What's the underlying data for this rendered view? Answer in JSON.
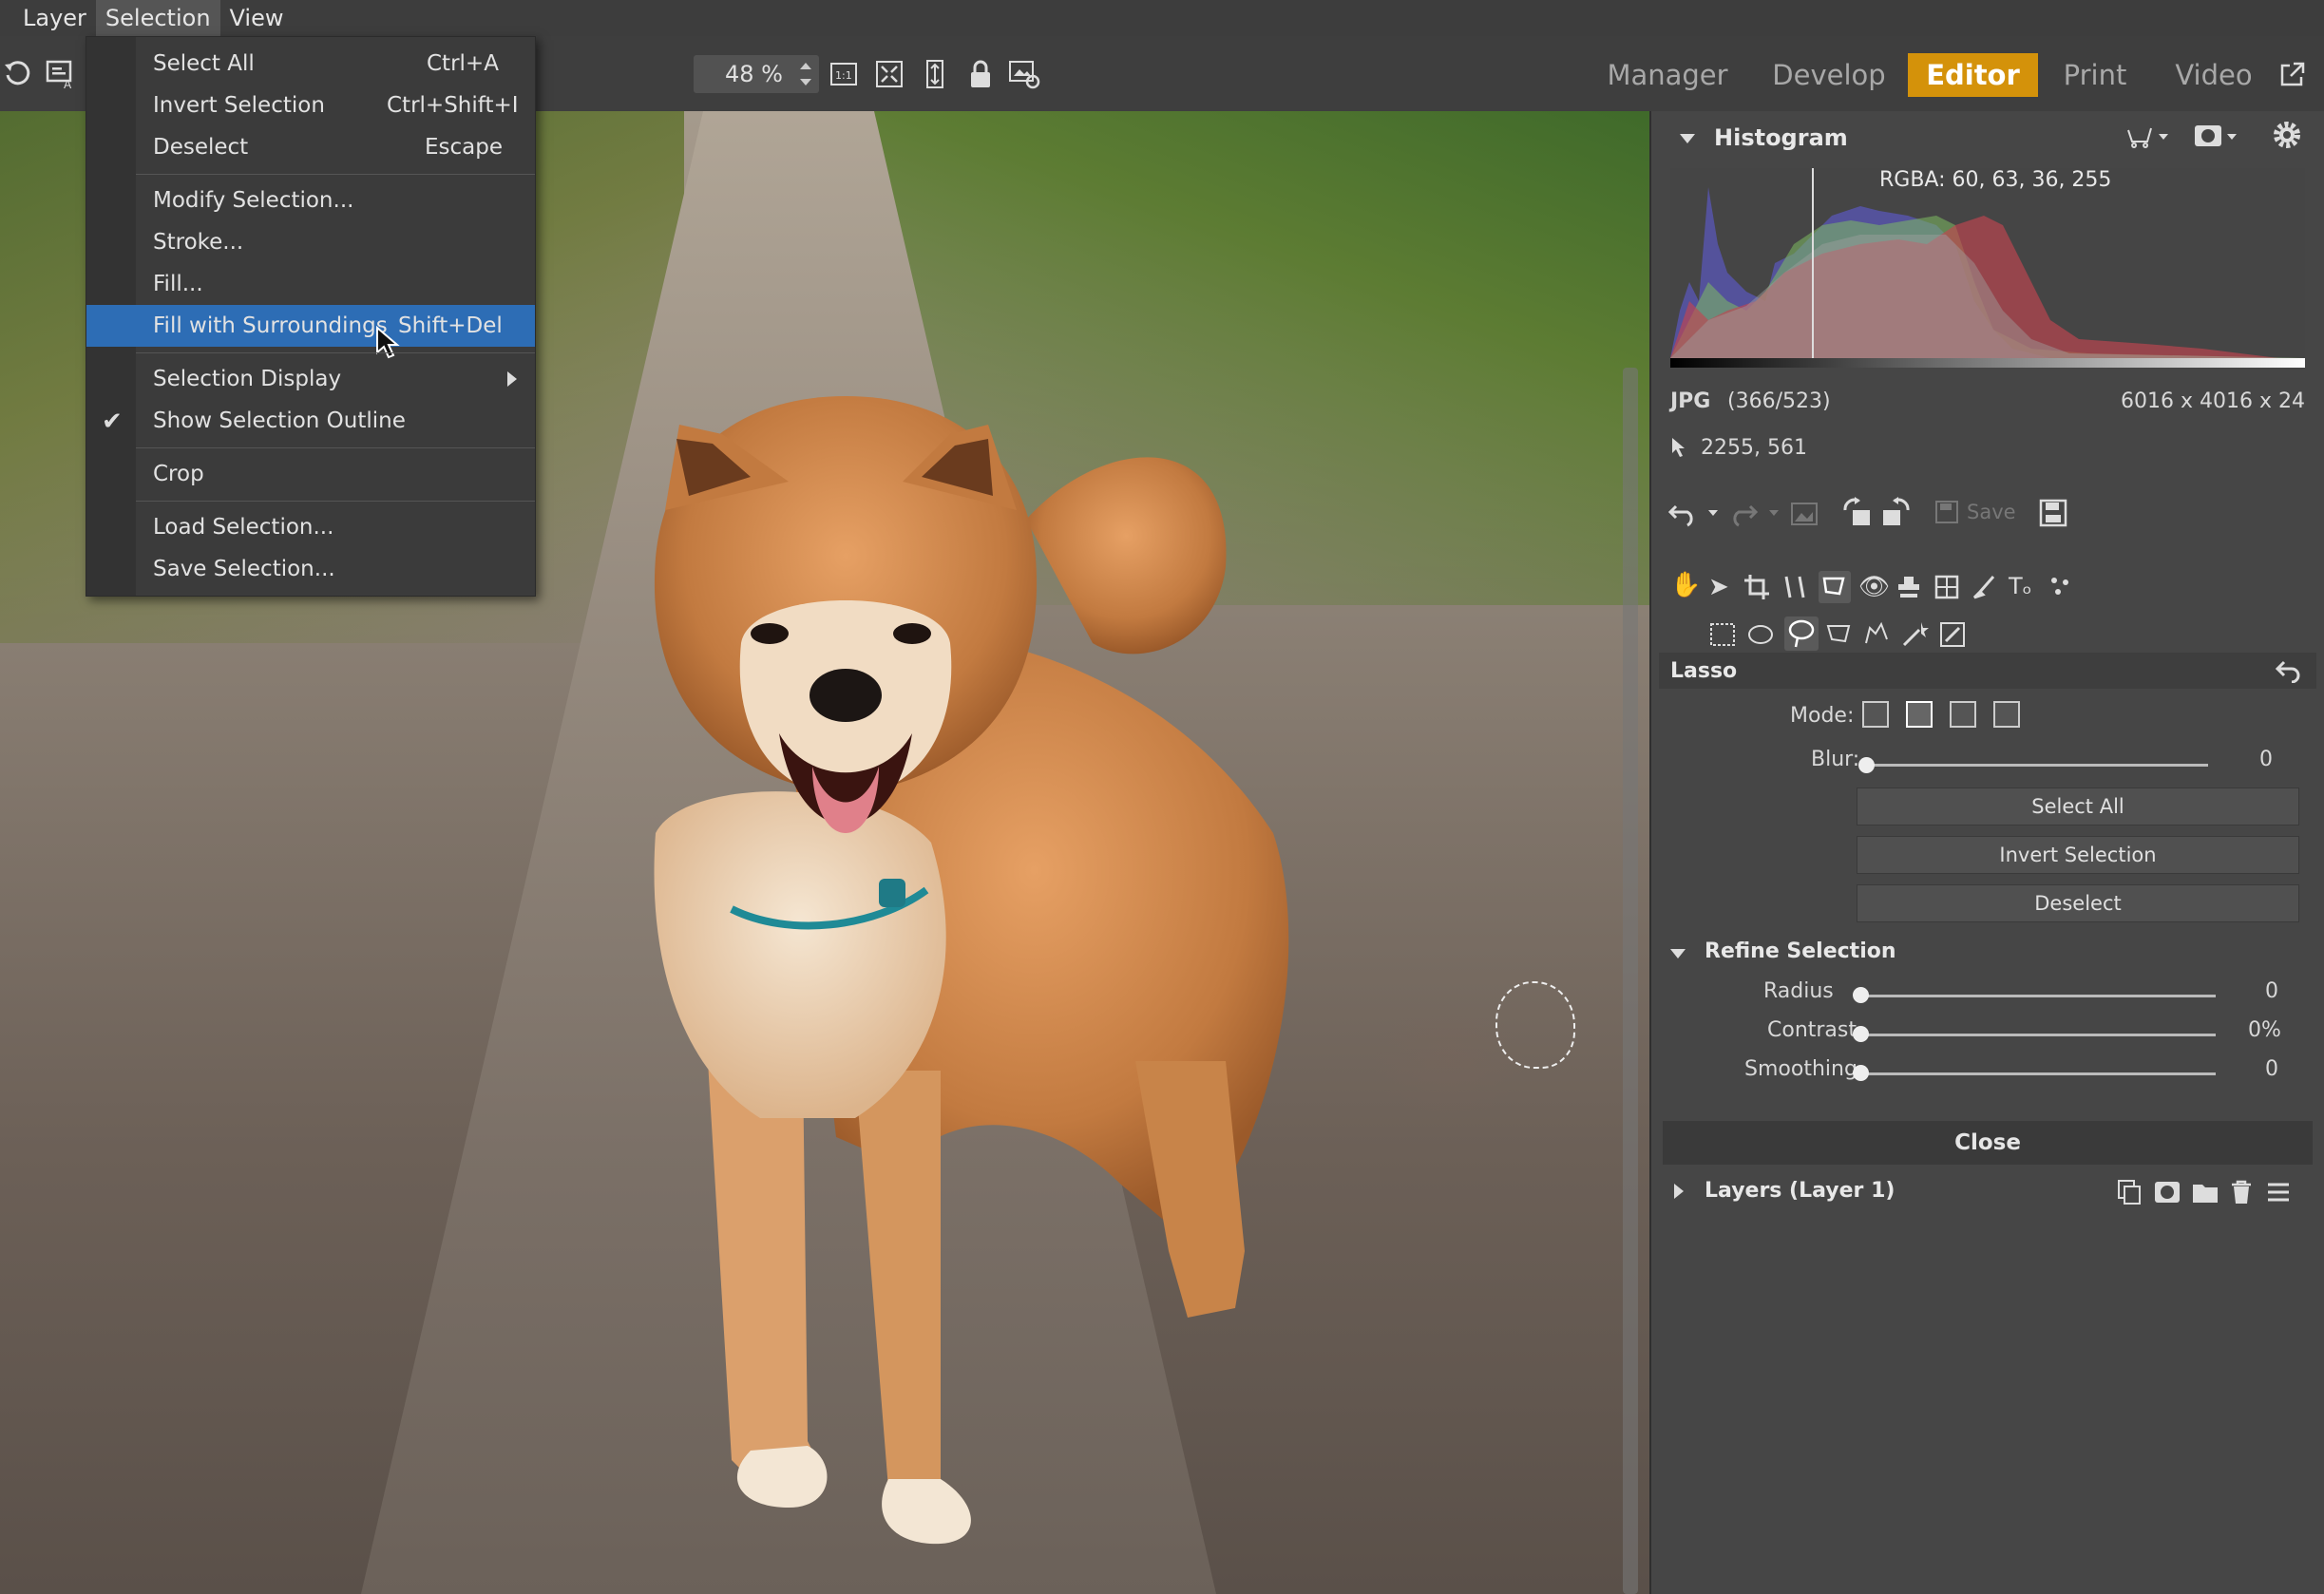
{
  "menubar": {
    "items": [
      "Layer",
      "Selection",
      "View"
    ],
    "active": "Selection"
  },
  "toolbar": {
    "zoom_value": "48 %",
    "icons": [
      "refresh-icon",
      "auto-enhance-icon",
      "actual-size-icon",
      "fit-icon",
      "fill-icon",
      "split-view-icon",
      "lock-icon",
      "settings-icon"
    ]
  },
  "mode_tabs": {
    "items": [
      "Manager",
      "Develop",
      "Editor",
      "Print",
      "Video"
    ],
    "active": "Editor"
  },
  "context_menu": {
    "items": [
      {
        "label": "Select All",
        "shortcut": "Ctrl+A"
      },
      {
        "label": "Invert Selection",
        "shortcut": "Ctrl+Shift+I"
      },
      {
        "label": "Deselect",
        "shortcut": "Escape"
      },
      {
        "label": "Modify Selection...",
        "shortcut": ""
      },
      {
        "label": "Stroke...",
        "shortcut": ""
      },
      {
        "label": "Fill...",
        "shortcut": ""
      },
      {
        "label": "Fill with Surroundings",
        "shortcut": "Shift+Del"
      },
      {
        "label": "Selection Display",
        "shortcut": ""
      },
      {
        "label": "Show Selection Outline",
        "shortcut": ""
      },
      {
        "label": "Crop",
        "shortcut": ""
      },
      {
        "label": "Load Selection...",
        "shortcut": ""
      },
      {
        "label": "Save Selection..."
      }
    ],
    "highlighted": "Fill with Surroundings",
    "checked": "Show Selection Outline"
  },
  "histogram": {
    "title": "Histogram",
    "rgba": "RGBA:  60,  63,  36, 255",
    "format": "JPG",
    "index": "(366/523)",
    "dimensions": "6016 x 4016 x 24",
    "cursor": "2255, 561"
  },
  "edit_toolbar": {
    "save_label": "Save"
  },
  "lasso": {
    "title": "Lasso",
    "mode_label": "Mode:",
    "blur_label": "Blur:",
    "blur_value": "0",
    "buttons": [
      "Select All",
      "Invert Selection",
      "Deselect"
    ]
  },
  "refine": {
    "title": "Refine Selection",
    "rows": [
      {
        "label": "Radius",
        "value": "0"
      },
      {
        "label": "Contrast",
        "value": "0%"
      },
      {
        "label": "Smoothing",
        "value": "0"
      }
    ]
  },
  "close_label": "Close",
  "layers": {
    "title": "Layers (Layer 1)"
  },
  "colors": {
    "accent": "#d4920a",
    "highlight": "#2d6db5",
    "panel": "#464646"
  }
}
